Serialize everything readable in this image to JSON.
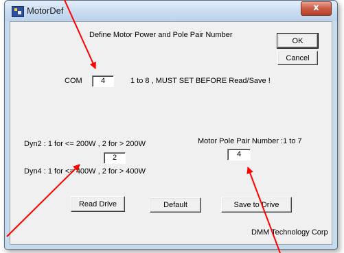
{
  "window": {
    "title": "MotorDef",
    "close_glyph": "x"
  },
  "dialog": {
    "heading": "Define Motor Power and Pole Pair Number",
    "ok_label": "OK",
    "cancel_label": "Cancel",
    "com_label": "COM",
    "com_value": "4",
    "com_hint": "1 to 8 , MUST SET BEFORE Read/Save !",
    "dyn2_text": "Dyn2 : 1 for <= 200W , 2 for >  200W",
    "dyn_value": "2",
    "dyn4_text": "Dyn4 : 1 for <= 400W , 2 for >  400W",
    "pole_label": "Motor Pole Pair Number :1 to 7",
    "pole_value": "4",
    "read_label": "Read Drive",
    "default_label": "Default",
    "save_label": "Save to Drive",
    "company": "DMM Technology Corp"
  },
  "annotations": {
    "arrow_color": "#ff0000"
  },
  "icons": [
    "app-icon",
    "close-icon"
  ]
}
